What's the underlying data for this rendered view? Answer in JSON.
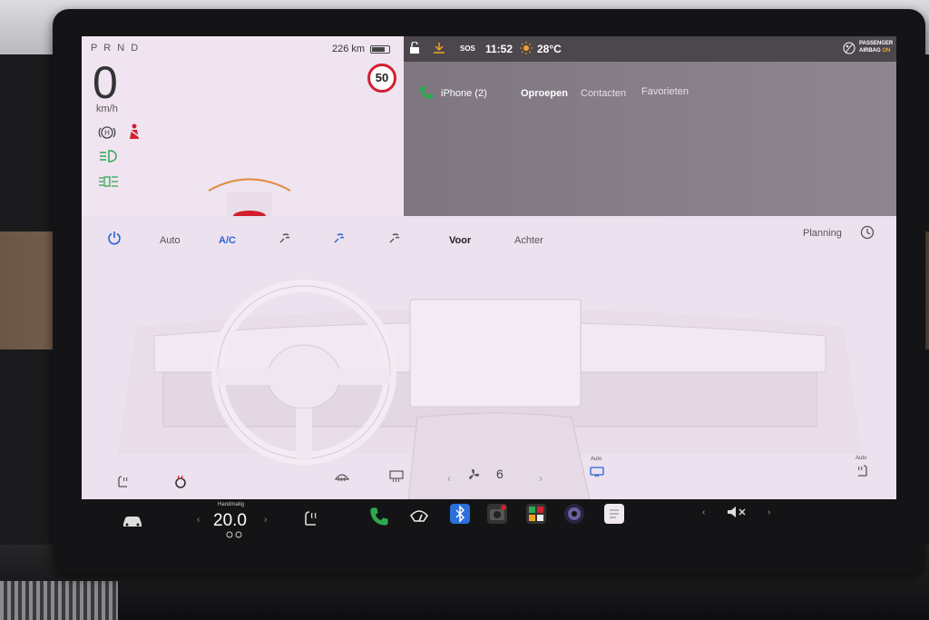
{
  "driver": {
    "gear": "P R N D",
    "range": "226 km",
    "speed": "0",
    "speed_unit": "km/h",
    "speed_limit": "50",
    "battery_level": 0.65,
    "icons": [
      "auto-hold-icon",
      "seatbelt-warning-icon",
      "headlight-icon",
      "fog-light-icon",
      "road-arc-icon"
    ]
  },
  "status": {
    "sos": "SOS",
    "time": "11:52",
    "temperature": "28°C",
    "airbag_line1": "PASSENGER",
    "airbag_line2": "AIRBAG",
    "airbag_state": "ON",
    "airbag_state_color": "#f4a12a"
  },
  "phone": {
    "device": "iPhone (2)",
    "tabs": [
      "Oproepen",
      "Contacten",
      "Favorieten"
    ],
    "active_tab": "Oproepen",
    "accent": "#2fa84f"
  },
  "climate": {
    "auto": "Auto",
    "ac": "A/C",
    "front": "Voor",
    "rear": "Achter",
    "schedule": "Planning",
    "fan_speed": "6",
    "auto_small": "Auto",
    "accent": "#2a63d6"
  },
  "dock": {
    "temp_mode": "Handmatig",
    "temp_value": "20.0",
    "apps": [
      "car-icon",
      "seat-heater-icon",
      "phone-icon",
      "wiper-icon",
      "bluetooth-icon",
      "camera-app-icon",
      "toybox-icon",
      "dashcam-icon",
      "notes-icon",
      "mute-icon"
    ]
  }
}
